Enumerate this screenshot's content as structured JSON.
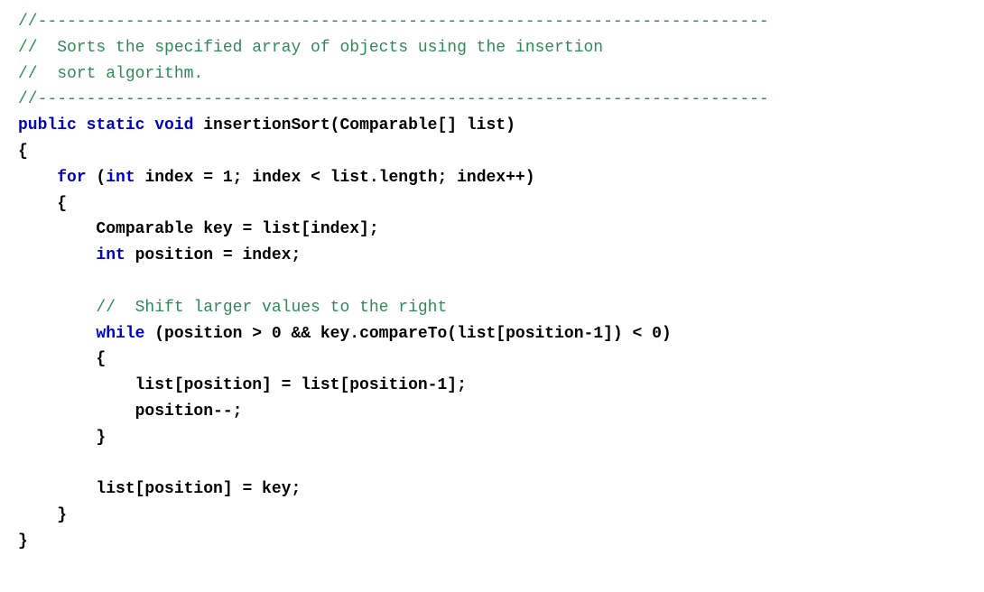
{
  "code": {
    "lines": [
      {
        "id": "line1",
        "parts": [
          {
            "text": "//---------------------------------------------------------------------------",
            "style": "comment"
          }
        ]
      },
      {
        "id": "line2",
        "parts": [
          {
            "text": "//  Sorts the specified array of objects using the insertion",
            "style": "comment"
          }
        ]
      },
      {
        "id": "line3",
        "parts": [
          {
            "text": "//  sort algorithm.",
            "style": "comment"
          }
        ]
      },
      {
        "id": "line4",
        "parts": [
          {
            "text": "//---------------------------------------------------------------------------",
            "style": "comment"
          }
        ]
      },
      {
        "id": "line5",
        "parts": [
          {
            "text": "public static void ",
            "style": "keyword"
          },
          {
            "text": "insertionSort(Comparable[] list)",
            "style": "normal"
          }
        ]
      },
      {
        "id": "line6",
        "parts": [
          {
            "text": "{",
            "style": "normal"
          }
        ]
      },
      {
        "id": "line7",
        "parts": [
          {
            "text": "    ",
            "style": "normal"
          },
          {
            "text": "for",
            "style": "keyword"
          },
          {
            "text": " (",
            "style": "normal"
          },
          {
            "text": "int",
            "style": "type"
          },
          {
            "text": " index = 1; index < list.length; index++)",
            "style": "normal"
          }
        ]
      },
      {
        "id": "line8",
        "parts": [
          {
            "text": "    {",
            "style": "normal"
          }
        ]
      },
      {
        "id": "line9",
        "parts": [
          {
            "text": "        Comparable key = list[index];",
            "style": "normal"
          }
        ]
      },
      {
        "id": "line10",
        "parts": [
          {
            "text": "        ",
            "style": "normal"
          },
          {
            "text": "int",
            "style": "type"
          },
          {
            "text": " position = index;",
            "style": "normal"
          }
        ]
      },
      {
        "id": "line11",
        "parts": [
          {
            "text": "",
            "style": "normal"
          }
        ]
      },
      {
        "id": "line12",
        "parts": [
          {
            "text": "        ",
            "style": "normal"
          },
          {
            "text": "//  Shift larger values to the right",
            "style": "comment"
          }
        ]
      },
      {
        "id": "line13",
        "parts": [
          {
            "text": "        ",
            "style": "normal"
          },
          {
            "text": "while",
            "style": "keyword"
          },
          {
            "text": " (position > 0 && key.compareTo(list[position-1]) < 0)",
            "style": "normal"
          }
        ]
      },
      {
        "id": "line14",
        "parts": [
          {
            "text": "        {",
            "style": "normal"
          }
        ]
      },
      {
        "id": "line15",
        "parts": [
          {
            "text": "            list[position] = list[position-1];",
            "style": "normal"
          }
        ]
      },
      {
        "id": "line16",
        "parts": [
          {
            "text": "            position--;",
            "style": "normal"
          }
        ]
      },
      {
        "id": "line17",
        "parts": [
          {
            "text": "        }",
            "style": "normal"
          }
        ]
      },
      {
        "id": "line18",
        "parts": [
          {
            "text": "",
            "style": "normal"
          }
        ]
      },
      {
        "id": "line19",
        "parts": [
          {
            "text": "        list[position] = key;",
            "style": "normal"
          }
        ]
      },
      {
        "id": "line20",
        "parts": [
          {
            "text": "    }",
            "style": "normal"
          }
        ]
      },
      {
        "id": "line21",
        "parts": [
          {
            "text": "}",
            "style": "normal"
          }
        ]
      }
    ]
  }
}
